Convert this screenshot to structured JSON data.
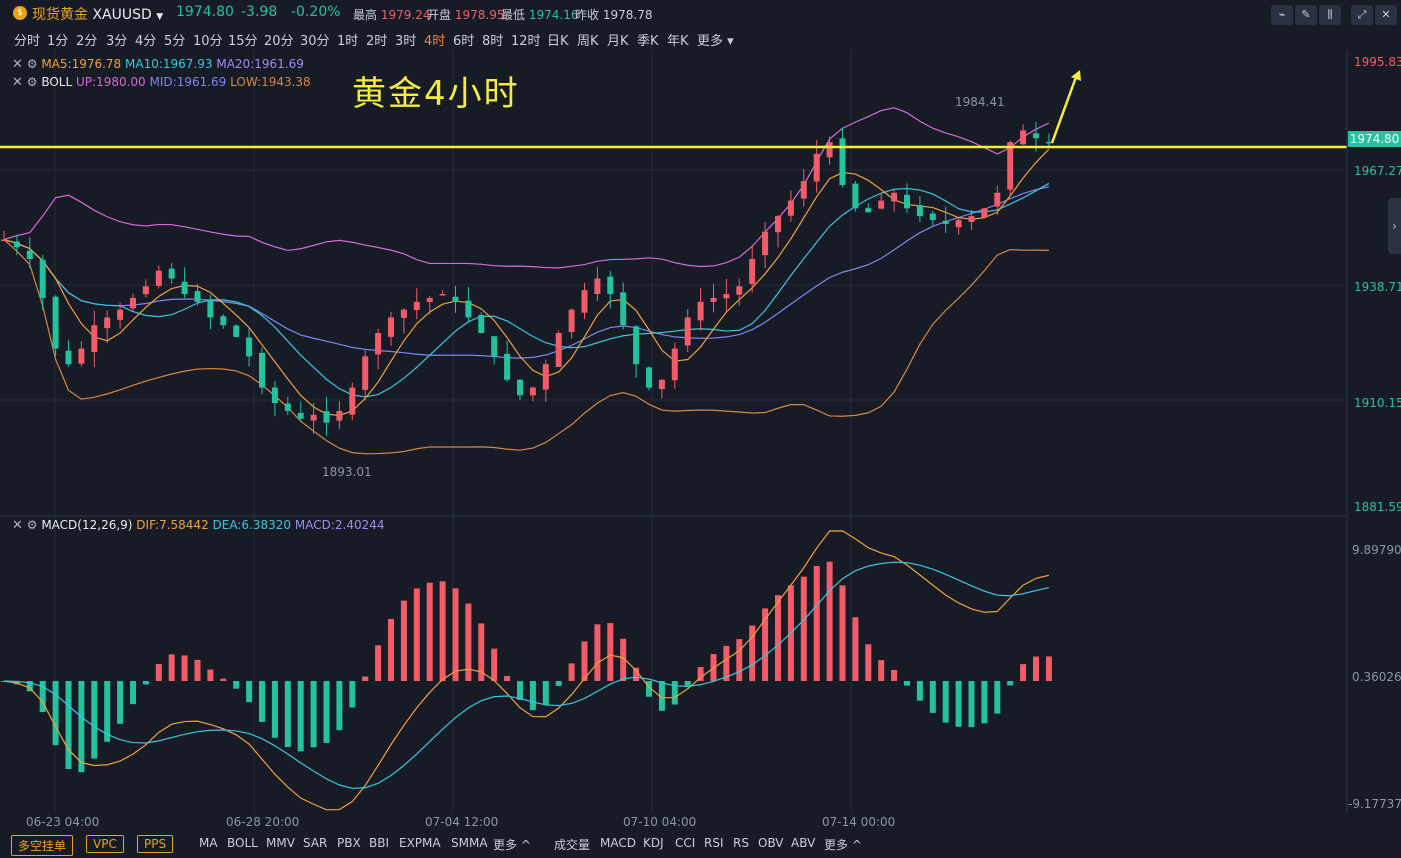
{
  "header": {
    "coin_icon": "coin-icon",
    "name_cn": "现货黄金",
    "symbol": "XAUUSD",
    "price": "1974.80",
    "change": "-3.98",
    "change_pct": "-0.20%",
    "high_label": "最高",
    "high": "1979.24",
    "open_label": "开盘",
    "open": "1978.95",
    "low_label": "最低",
    "low": "1974.16",
    "prev_label": "昨收",
    "prev": "1978.78",
    "colors": {
      "up": "#f25c68",
      "down": "#25c2a0",
      "accent": "#e9a419"
    }
  },
  "intervals": [
    "分时",
    "1分",
    "2分",
    "3分",
    "4分",
    "5分",
    "10分",
    "15分",
    "20分",
    "30分",
    "1时",
    "2时",
    "3时",
    "4时",
    "6时",
    "8时",
    "12时",
    "日K",
    "周K",
    "月K",
    "季K",
    "年K",
    "更多"
  ],
  "active_interval": "4时",
  "legend": {
    "ma": {
      "ma5": "MA5:1976.78",
      "ma10": "MA10:1967.93",
      "ma20": "MA20:1961.69"
    },
    "boll": {
      "name": "BOLL",
      "up": "UP:1980.00",
      "mid": "MID:1961.69",
      "low": "LOW:1943.38"
    },
    "macd": {
      "name": "MACD(12,26,9)",
      "dif": "DIF:7.58442",
      "dea": "DEA:6.38320",
      "macd": "MACD:2.40244"
    }
  },
  "annotation": "黄金4小时",
  "price_axis": {
    "labels": [
      "1995.83",
      "1967.27",
      "1938.71",
      "1910.15",
      "1881.59"
    ],
    "current": "1974.80"
  },
  "macd_axis": {
    "labels": [
      "9.89790",
      "0.36026",
      "-9.17737"
    ]
  },
  "markers": {
    "high": "1984.41",
    "low": "1893.01"
  },
  "time_axis": [
    "06-23 04:00",
    "06-28 20:00",
    "07-04 12:00",
    "07-10 04:00",
    "07-14 00:00"
  ],
  "bottom_tags": [
    "多空挂单",
    "VPC",
    "PPS"
  ],
  "bottom_main": [
    "MA",
    "BOLL",
    "MMV",
    "SAR",
    "PBX",
    "BBI",
    "EXPMA",
    "SMMA",
    "更多 ^"
  ],
  "bottom_sub": [
    "成交量",
    "MACD",
    "KDJ",
    "CCI",
    "RSI",
    "RS",
    "OBV",
    "ABV",
    "更多 ^"
  ],
  "chart_data": {
    "type": "candlestick",
    "close_series": [
      1950,
      1948,
      1945,
      1935,
      1922,
      1918,
      1922,
      1928,
      1930,
      1932,
      1935,
      1938,
      1942,
      1940,
      1936,
      1934,
      1930,
      1928,
      1925,
      1920,
      1912,
      1908,
      1906,
      1904,
      1905,
      1903,
      1906,
      1912,
      1920,
      1926,
      1930,
      1932,
      1934,
      1935,
      1936,
      1934,
      1930,
      1926,
      1920,
      1914,
      1910,
      1912,
      1918,
      1926,
      1932,
      1937,
      1940,
      1936,
      1928,
      1918,
      1912,
      1914,
      1922,
      1930,
      1934,
      1935,
      1936,
      1938,
      1945,
      1952,
      1956,
      1960,
      1965,
      1972,
      1975,
      1964,
      1958,
      1957,
      1960,
      1962,
      1958,
      1956,
      1955,
      1954,
      1955,
      1956,
      1958,
      1962,
      1975,
      1978,
      1976,
      1975
    ]
  }
}
